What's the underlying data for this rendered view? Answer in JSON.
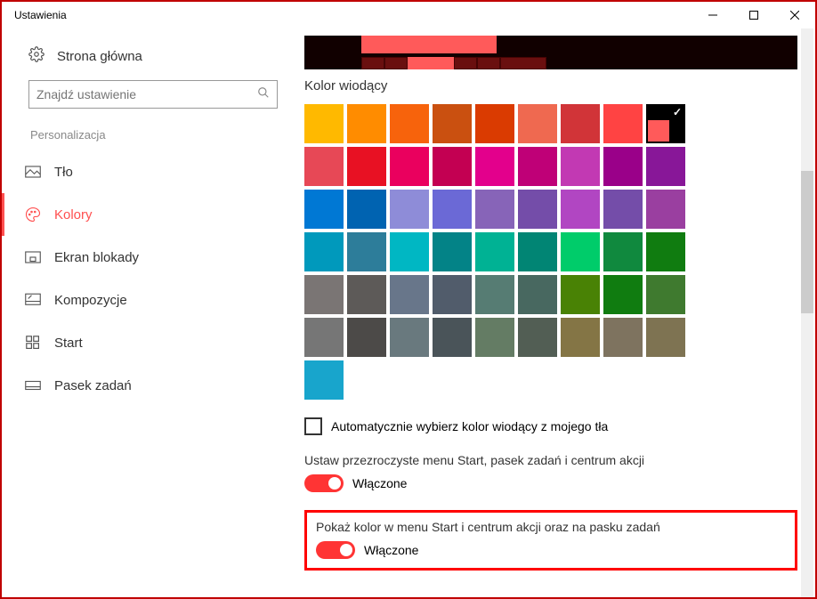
{
  "window": {
    "title": "Ustawienia"
  },
  "sidebar": {
    "home": "Strona główna",
    "search_placeholder": "Znajdź ustawienie",
    "category": "Personalizacja",
    "items": [
      {
        "label": "Tło"
      },
      {
        "label": "Kolory"
      },
      {
        "label": "Ekran blokady"
      },
      {
        "label": "Kompozycje"
      },
      {
        "label": "Start"
      },
      {
        "label": "Pasek zadań"
      }
    ]
  },
  "colors": {
    "section_title": "Kolor wiodący",
    "swatches": [
      "#ffb900",
      "#ff8c00",
      "#f7630c",
      "#ca5010",
      "#da3b01",
      "#ef6950",
      "#d13438",
      "#ff4343",
      "#000000",
      "#e74856",
      "#e81123",
      "#ea005e",
      "#c30052",
      "#e3008c",
      "#bf0077",
      "#c239b3",
      "#9a0089",
      "#881798",
      "#0078d4",
      "#0063b1",
      "#8e8cd8",
      "#6b69d6",
      "#8764b8",
      "#744da9",
      "#b146c2",
      "#744da9",
      "#9a3fa0",
      "#0099bc",
      "#2d7d9a",
      "#00b7c3",
      "#038387",
      "#00b294",
      "#018574",
      "#00cc6a",
      "#10893e",
      "#107c10",
      "#7a7574",
      "#5d5a58",
      "#68768a",
      "#515c6b",
      "#567c73",
      "#486860",
      "#498205",
      "#107c10",
      "#3f7a2f",
      "#767676",
      "#4c4a48",
      "#69797e",
      "#4a5459",
      "#647c64",
      "#525e54",
      "#847545",
      "#7e735f",
      "#7e7352",
      "#18a5cc"
    ],
    "selected_index": 8,
    "selected_accent": "#ff5a5a",
    "auto_label": "Automatycznie wybierz kolor wiodący z mojego tła",
    "transparency_label": "Ustaw przezroczyste menu Start, pasek zadań i centrum akcji",
    "transparency_state": "Włączone",
    "show_color_label": "Pokaż kolor w menu Start i centrum akcji oraz na pasku zadań",
    "show_color_state": "Włączone"
  }
}
